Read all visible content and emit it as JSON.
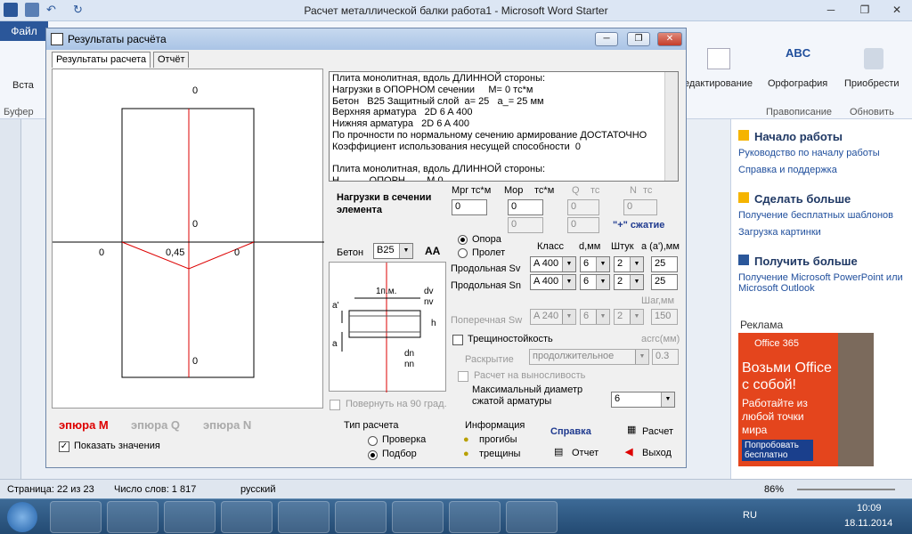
{
  "word": {
    "title": "Расчет металлической балки работа1  -  Microsoft Word Starter",
    "file_tab": "Файл",
    "ribbon": {
      "paste": "Вста",
      "buffer_group": "Буфер",
      "editing": "едактирование",
      "spelling": "Орфография",
      "spelling_icon_text": "ABC",
      "upgrade": "Приобрести",
      "proofing_group": "Правописание",
      "update_group": "Обновить"
    }
  },
  "pane": {
    "sections": [
      {
        "title": "Начало работы",
        "links": [
          "Руководство по началу работы",
          "Справка и поддержка"
        ]
      },
      {
        "title": "Сделать больше",
        "links": [
          "Получение бесплатных шаблонов",
          "Загрузка картинки"
        ]
      },
      {
        "title": "Получить больше",
        "links": [
          "Получение Microsoft PowerPoint или Microsoft Outlook"
        ]
      }
    ],
    "ad_label": "Реклама",
    "ad": {
      "brand": "Office 365",
      "headline": "Возьми Office с собой!",
      "body": "Работайте из любой точки мира",
      "button": "Попробовать бесплатно"
    }
  },
  "status": {
    "page": "Страница: 22 из 23",
    "words": "Число слов: 1 817",
    "lang": "русский",
    "zoom": "86%"
  },
  "taskbar": {
    "lang": "RU",
    "time": "10:09",
    "date": "18.11.2014"
  },
  "dialog": {
    "title": "Результаты расчёта",
    "tabs": [
      "Результаты расчета",
      "Отчёт"
    ],
    "diagram": {
      "label_top": "0",
      "label_mid": "0",
      "label_left": "0",
      "label_value": "0,45",
      "label_right": "0",
      "label_bottom": "0"
    },
    "report_lines": [
      "Плита монолитная, вдоль ДЛИННОЙ стороны:",
      "Нагрузки в ОПОРНОМ сечении     M= 0 тс*м",
      "Бетон   B25 Защитный слой  a= 25   a_= 25 мм",
      "Верхняя арматура   2D 6 A 400",
      "Нижняя арматура   2D 6 A 400",
      "По прочности по нормальному сечению армирование ДОСТАТОЧНО",
      "Коэффициент использования несущей способности  0",
      "",
      "Плита монолитная, вдоль ДЛИННОЙ стороны:",
      "Н           ОПОРН        М 0 "
    ],
    "loads_label": "Нагрузки в сечении элемента",
    "load_headers": [
      "Mpr тс*м",
      "Mop",
      "тс*м",
      "Q",
      "тс",
      "N",
      "тс"
    ],
    "loads": {
      "mpr": "0",
      "mop": "0",
      "mop2": "0",
      "q": "0",
      "q2": "0",
      "n": "0"
    },
    "compression": "\"+\" сжатие",
    "concrete_label": "Бетон",
    "concrete_value": "B25",
    "font_btn": "AA",
    "support_label": "Опора",
    "span_label": "Пролет",
    "rebar_headers": [
      "Класс",
      "d,мм",
      "Штук",
      "a (a'),мм"
    ],
    "sv": {
      "label": "Продольная Sv",
      "cls": "A 400",
      "d": "6",
      "n": "2",
      "a": "25"
    },
    "sn": {
      "label": "Продольная Sn",
      "cls": "A 400",
      "d": "6",
      "n": "2",
      "a": "25"
    },
    "step_label": "Шаг,мм",
    "sw": {
      "label": "Поперечная Sw",
      "cls": "A 240",
      "d": "6",
      "n": "2",
      "step": "150"
    },
    "section": {
      "a_top": "a'",
      "dim": "1п.м.",
      "dv": "dv",
      "nv": "nv",
      "h": "h",
      "a_bot": "a",
      "dn": "dn",
      "nn": "nn"
    },
    "crack_label": "Трещиностойкость",
    "acrc_label": "acrc(мм)",
    "opening_label": "Раскрытие",
    "opening_value": "продолжительное",
    "acrc_value": "0.3",
    "fatigue_label": "Расчет на выносливость",
    "maxdia_label": "Максимальный диаметр сжатой арматуры",
    "maxdia_value": "6",
    "rotate_label": "Повернуть на 90 град.",
    "epura_m": "эпюра M",
    "epura_q": "эпюра Q",
    "epura_n": "эпюра N",
    "show_values": "Показать значения",
    "calc_type": "Тип расчета",
    "check": "Проверка",
    "select": "Подбор",
    "info": "Информация",
    "deflection": "прогибы",
    "cracks": "трещины",
    "help": "Справка",
    "report": "Отчет",
    "calc": "Расчет",
    "exit": "Выход"
  }
}
